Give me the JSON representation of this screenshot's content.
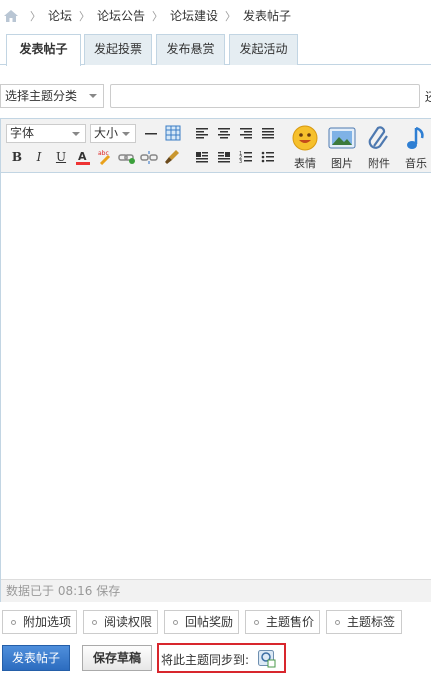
{
  "breadcrumb": {
    "items": [
      "论坛",
      "论坛公告",
      "论坛建设",
      "发表帖子"
    ]
  },
  "tabs": [
    "发表帖子",
    "发起投票",
    "发布悬赏",
    "发起活动"
  ],
  "active_tab": 0,
  "subject": {
    "category_select": "选择主题分类",
    "title_value": "",
    "trailing_hint": "还"
  },
  "toolbar": {
    "font_select": "字体",
    "size_select": "大小",
    "buttons": [
      "B",
      "I",
      "U"
    ],
    "big_buttons": [
      "表情",
      "图片",
      "附件",
      "音乐"
    ]
  },
  "editor": {
    "status": "数据已于 08:16 保存"
  },
  "options": [
    "附加选项",
    "阅读权限",
    "回帖奖励",
    "主题售价",
    "主题标签"
  ],
  "actions": {
    "submit": "发表帖子",
    "save_draft": "保存草稿",
    "sync_label": "将此主题同步到:"
  },
  "colors": {
    "tab_bg": "#e5edf2",
    "border": "#c2d5e3",
    "primary_button": "#2c6cbf",
    "highlight_box": "#d8262d"
  }
}
